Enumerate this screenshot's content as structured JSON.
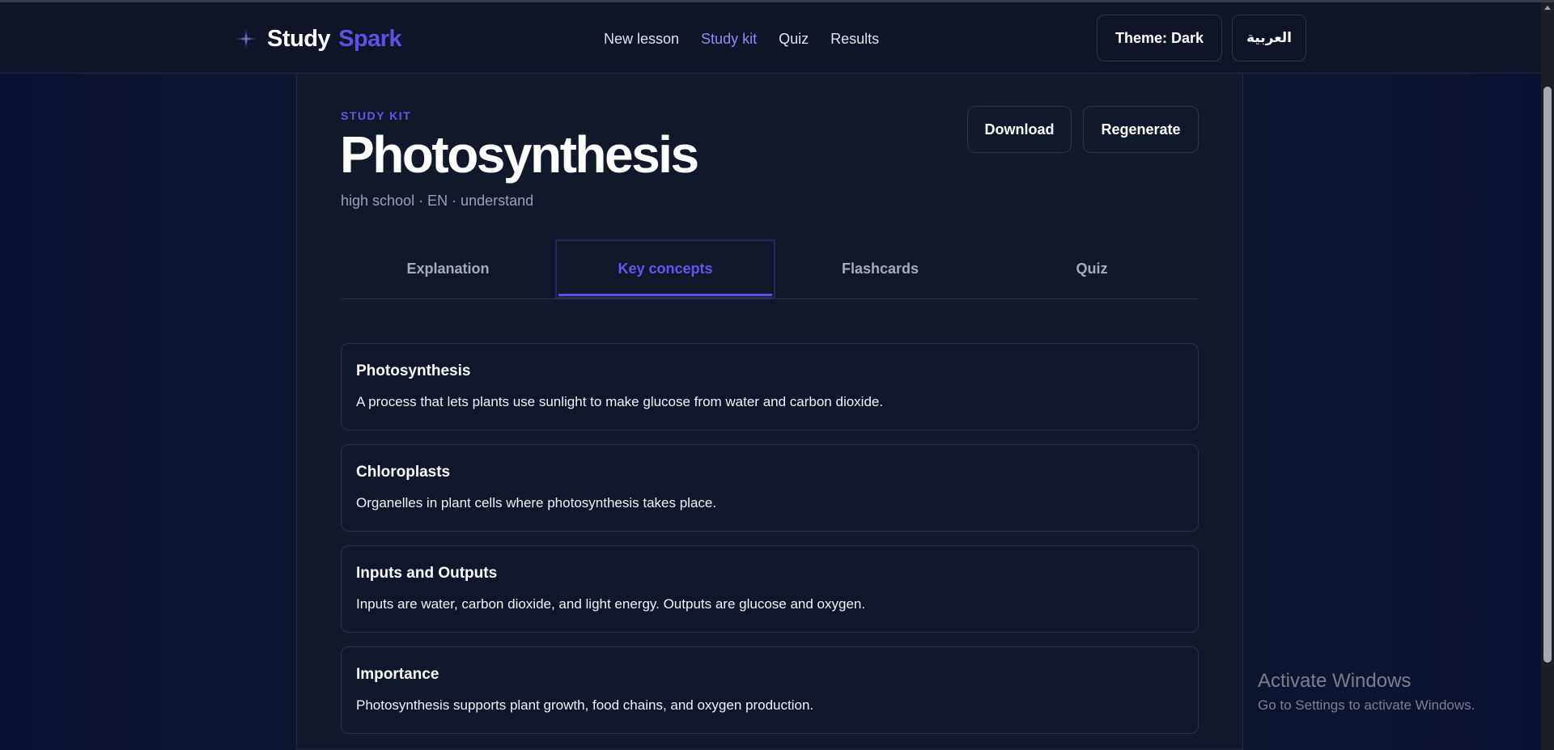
{
  "header": {
    "brand_first": "Study",
    "brand_second": "Spark",
    "nav": [
      "New lesson",
      "Study kit",
      "Quiz",
      "Results"
    ],
    "active_nav": "Study kit",
    "theme_button": "Theme: Dark",
    "language_button": "العربية",
    "colors": {
      "accent": "#5b51e6",
      "active_nav": "#8f8cf7"
    }
  },
  "study_kit": {
    "kicker": "STUDY KIT",
    "title": "Photosynthesis",
    "meta": "high school · EN · understand",
    "download_label": "Download",
    "regenerate_label": "Regenerate",
    "tabs": [
      "Explanation",
      "Key concepts",
      "Flashcards",
      "Quiz"
    ],
    "active_tab": "Key concepts"
  },
  "concepts": [
    {
      "title": "Photosynthesis",
      "description": "A process that lets plants use sunlight to make glucose from water and carbon dioxide."
    },
    {
      "title": "Chloroplasts",
      "description": "Organelles in plant cells where photosynthesis takes place."
    },
    {
      "title": "Inputs and Outputs",
      "description": "Inputs are water, carbon dioxide, and light energy. Outputs are glucose and oxygen."
    },
    {
      "title": "Importance",
      "description": "Photosynthesis supports plant growth, food chains, and oxygen production."
    }
  ],
  "watermark": {
    "title": "Activate Windows",
    "subtitle": "Go to Settings to activate Windows."
  }
}
